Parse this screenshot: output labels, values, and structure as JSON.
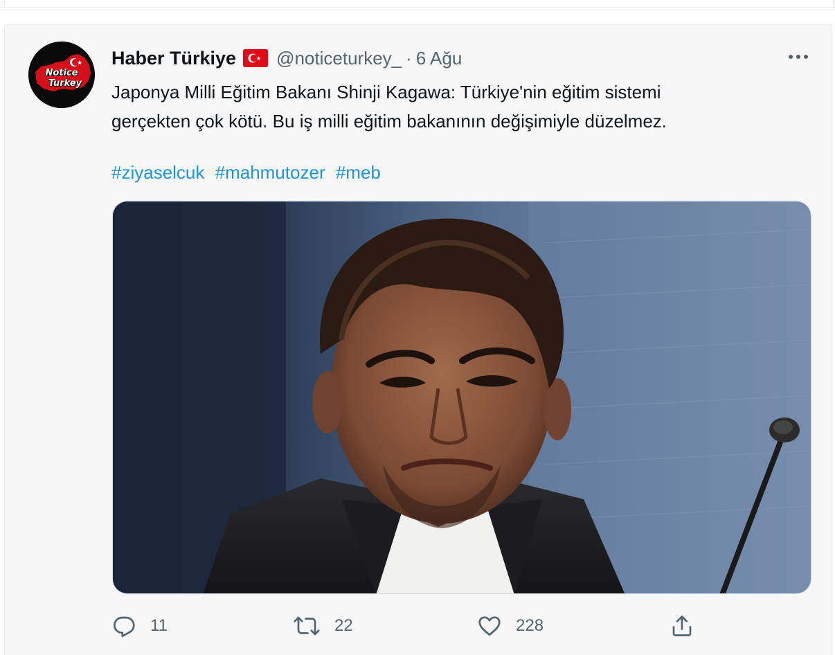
{
  "tweet": {
    "avatar_text": [
      "Notice",
      "Turkey"
    ],
    "display_name": "Haber Türkiye",
    "flag_icon": "turkey-flag-icon",
    "handle": "@noticeturkey_",
    "separator": "·",
    "date": "6 Ağu",
    "text_lines": [
      "Japonya Milli Eğitim Bakanı Shinji Kagawa: Türkiye'nin eğitim sistemi",
      "gerçekten çok kötü. Bu iş milli eğitim bakanının değişimiyle düzelmez."
    ],
    "hashtags": [
      "#ziyaselcuk",
      "#mahmutozer",
      "#meb"
    ],
    "media_description_icon": "photo",
    "actions": {
      "reply_count": "11",
      "retweet_count": "22",
      "like_count": "228"
    }
  },
  "colors": {
    "background": "#f7f7f7",
    "text": "#0f1419",
    "secondary": "#536471",
    "link": "#1b95e0",
    "flag_red": "#e30a17"
  }
}
